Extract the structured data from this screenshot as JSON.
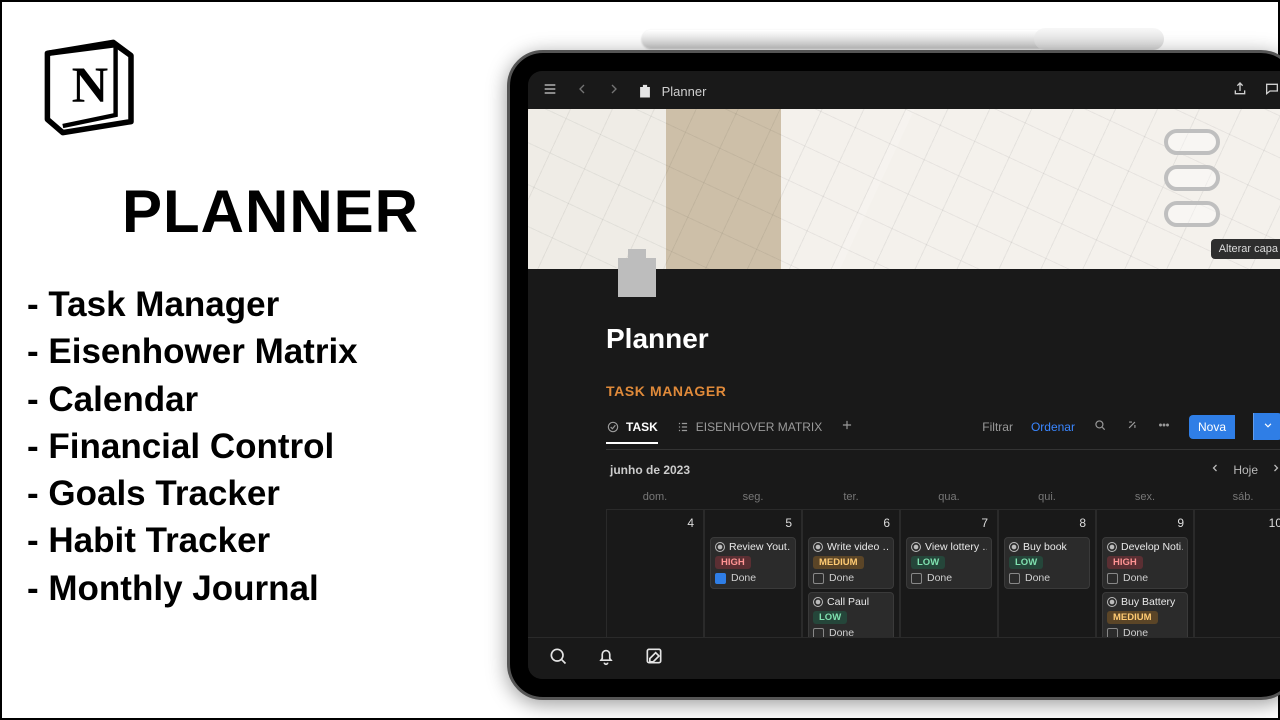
{
  "left": {
    "title": "PLANNER",
    "features": [
      "Task Manager",
      "Eisenhower Matrix",
      "Calendar",
      "Financial Control",
      "Goals Tracker",
      "Habit Tracker",
      "Monthly Journal"
    ]
  },
  "topbar": {
    "breadcrumb": "Planner"
  },
  "cover": {
    "change_label": "Alterar capa"
  },
  "page": {
    "title": "Planner",
    "section": "TASK MANAGER"
  },
  "views": {
    "tabs": [
      {
        "label": "TASK",
        "active": true
      },
      {
        "label": "EISENHOVER MATRIX",
        "active": false
      }
    ],
    "filter": "Filtrar",
    "sort": "Ordenar",
    "new": "Nova"
  },
  "calendar": {
    "month_label": "junho de 2023",
    "today": "Hoje",
    "dows": [
      "dom.",
      "seg.",
      "ter.",
      "qua.",
      "qui.",
      "sex.",
      "sáb."
    ],
    "days": [
      4,
      5,
      6,
      7,
      8,
      9,
      10
    ],
    "done_label": "Done",
    "columns": [
      {
        "day": 4,
        "cards": []
      },
      {
        "day": 5,
        "cards": [
          {
            "title": "Review Yout…",
            "priority": "HIGH",
            "done_checked": true
          }
        ]
      },
      {
        "day": 6,
        "cards": [
          {
            "title": "Write video …",
            "priority": "MEDIUM",
            "done_checked": false
          },
          {
            "title": "Call Paul",
            "priority": "LOW",
            "done_checked": false
          }
        ]
      },
      {
        "day": 7,
        "cards": [
          {
            "title": "View lottery …",
            "priority": "LOW",
            "done_checked": false
          }
        ]
      },
      {
        "day": 8,
        "cards": [
          {
            "title": "Buy book",
            "priority": "LOW",
            "done_checked": false
          }
        ]
      },
      {
        "day": 9,
        "cards": [
          {
            "title": "Develop Noti…",
            "priority": "HIGH",
            "done_checked": false
          },
          {
            "title": "Buy Battery",
            "priority": "MEDIUM",
            "done_checked": false
          }
        ]
      },
      {
        "day": 10,
        "cards": []
      }
    ]
  }
}
